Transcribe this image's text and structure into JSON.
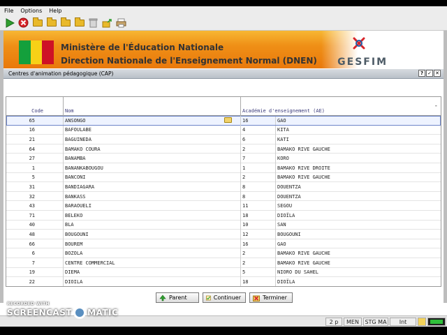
{
  "menu": {
    "file": "File",
    "options": "Options",
    "help": "Help"
  },
  "banner": {
    "line1": "Ministère de l'Éducation Nationale",
    "line2": "Direction Nationale de l'Enseignement Normal (DNEN)",
    "logo_text": "GESFIM",
    "flag_colors": [
      "#14a03c",
      "#f7d117",
      "#ce1126"
    ]
  },
  "window": {
    "title": "Centres d'animation pédagogique (CAP)",
    "btn_help": "?",
    "btn_ok": "✓",
    "btn_close": "✕"
  },
  "table": {
    "columns": {
      "code": "Code",
      "nom": "Nom",
      "academie": "Académie d'enseignement (AE)"
    },
    "collapse": "-",
    "rows": [
      {
        "code": "65",
        "nom": "ANSONGO",
        "ae_code": "16",
        "ae_nom": "GAO"
      },
      {
        "code": "16",
        "nom": "BAFOULABE",
        "ae_code": "4",
        "ae_nom": "KITA"
      },
      {
        "code": "21",
        "nom": "BAGUINEDA",
        "ae_code": "6",
        "ae_nom": "KATI"
      },
      {
        "code": "64",
        "nom": "BAMAKO COURA",
        "ae_code": "2",
        "ae_nom": "BAMAKO RIVE GAUCHE"
      },
      {
        "code": "27",
        "nom": "BANAMBA",
        "ae_code": "7",
        "ae_nom": "KORO"
      },
      {
        "code": "1",
        "nom": "BANANKABOUGOU",
        "ae_code": "1",
        "ae_nom": "BAMAKO RIVE DROITE"
      },
      {
        "code": "5",
        "nom": "BANCONI",
        "ae_code": "2",
        "ae_nom": "BAMAKO RIVE GAUCHE"
      },
      {
        "code": "31",
        "nom": "BANDIAGARA",
        "ae_code": "8",
        "ae_nom": "DOUENTZA"
      },
      {
        "code": "32",
        "nom": "BANKASS",
        "ae_code": "8",
        "ae_nom": "DOUENTZA"
      },
      {
        "code": "43",
        "nom": "BARAOUELI",
        "ae_code": "11",
        "ae_nom": "SEGOU"
      },
      {
        "code": "71",
        "nom": "BELEKO",
        "ae_code": "18",
        "ae_nom": "DIOÏLA"
      },
      {
        "code": "40",
        "nom": "BLA",
        "ae_code": "10",
        "ae_nom": "SAN"
      },
      {
        "code": "48",
        "nom": "BOUGOUNI",
        "ae_code": "12",
        "ae_nom": "BOUGOUNI"
      },
      {
        "code": "66",
        "nom": "BOUREM",
        "ae_code": "16",
        "ae_nom": "GAO"
      },
      {
        "code": "6",
        "nom": "BOZOLA",
        "ae_code": "2",
        "ae_nom": "BAMAKO RIVE GAUCHE"
      },
      {
        "code": "7",
        "nom": "CENTRE COMMERCIAL",
        "ae_code": "2",
        "ae_nom": "BAMAKO RIVE GAUCHE"
      },
      {
        "code": "19",
        "nom": "DIEMA",
        "ae_code": "5",
        "ae_nom": "NIORO DU SAHEL"
      },
      {
        "code": "22",
        "nom": "DIOILA",
        "ae_code": "18",
        "ae_nom": "DIOÏLA"
      }
    ]
  },
  "buttons": {
    "parent": "Parent",
    "continuer": "Continuer",
    "terminer": "Terminer"
  },
  "status": {
    "pages": "2 p",
    "men": "MEN",
    "stg": "STG MA",
    "int": "Int"
  },
  "watermark": {
    "recorded": "RECORDED WITH",
    "left": "SCREENCAST",
    "right": "MATIC"
  }
}
